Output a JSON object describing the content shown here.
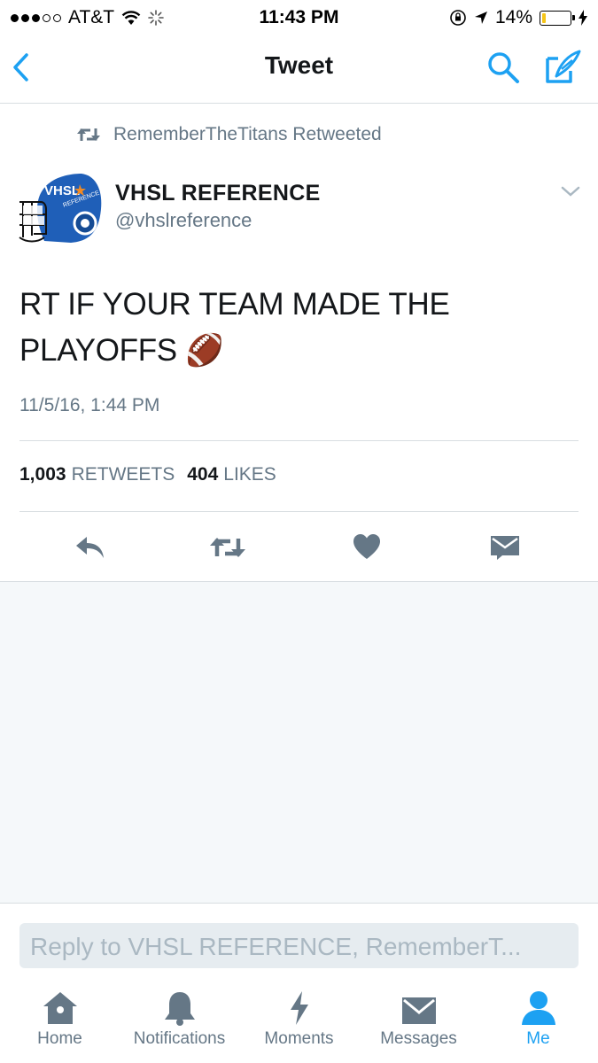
{
  "status_bar": {
    "carrier": "AT&T",
    "time": "11:43 PM",
    "battery": "14%",
    "battery_level": 0.14
  },
  "nav": {
    "title": "Tweet",
    "back_icon": "chevron-left-icon",
    "search_icon": "search-icon",
    "compose_icon": "compose-icon"
  },
  "tweet": {
    "retweeted_by": "RememberTheTitans Retweeted",
    "avatar_text": "VHSL",
    "avatar_subtext": "REFERENCE",
    "author_name": "VHSL REFERENCE",
    "author_handle": "@vhslreference",
    "text": "RT IF YOUR TEAM MADE THE PLAYOFFS 🏈",
    "timestamp": "11/5/16, 1:44 PM",
    "retweet_count": "1,003",
    "retweet_label": "RETWEETS",
    "like_count": "404",
    "like_label": "LIKES"
  },
  "reply": {
    "placeholder": "Reply to VHSL REFERENCE, RememberT..."
  },
  "tabs": [
    {
      "label": "Home",
      "icon": "home-icon"
    },
    {
      "label": "Notifications",
      "icon": "bell-icon"
    },
    {
      "label": "Moments",
      "icon": "lightning-icon"
    },
    {
      "label": "Messages",
      "icon": "envelope-icon"
    },
    {
      "label": "Me",
      "icon": "person-icon",
      "active": true
    }
  ],
  "colors": {
    "accent": "#1da1f2",
    "secondary_text": "#657786",
    "icon_gray": "#657786"
  }
}
